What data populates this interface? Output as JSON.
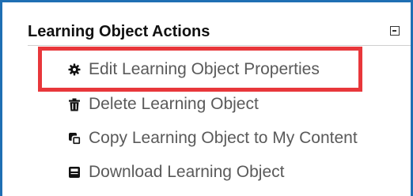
{
  "panel": {
    "title": "Learning Object Actions",
    "collapse_icon": "minus-square-icon"
  },
  "actions": [
    {
      "label": "Edit Learning Object Properties",
      "icon": "gear-icon",
      "highlighted": true
    },
    {
      "label": "Delete Learning Object",
      "icon": "trash-icon"
    },
    {
      "label": "Copy Learning Object to My Content",
      "icon": "copy-icon"
    },
    {
      "label": "Download Learning Object",
      "icon": "download-icon"
    }
  ],
  "colors": {
    "frame_border": "#1f6fb3",
    "highlight_border": "#e8373b",
    "label_text": "#5a5a5a",
    "title_text": "#111111"
  }
}
